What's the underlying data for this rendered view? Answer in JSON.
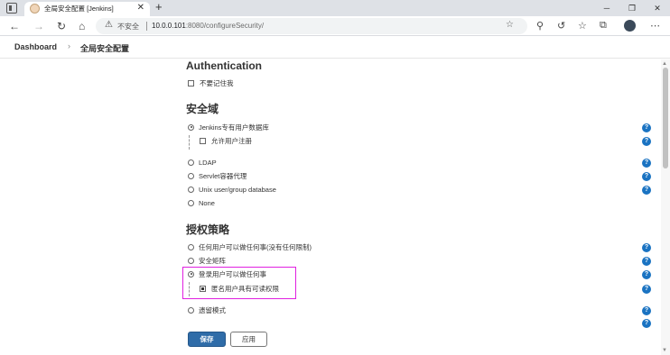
{
  "browser": {
    "tab_title": "全局安全配置 [Jenkins]",
    "tab_close": "✕",
    "new_tab": "+",
    "insecure_label": "不安全",
    "url_host": "10.0.0.101",
    "url_rest": ":8080/configureSecurity/",
    "window_controls": {
      "minimize": "─",
      "maximize": "❐",
      "close": "✕"
    },
    "nav": {
      "back": "←",
      "forward": "→",
      "reload": "↻",
      "home": "⌂"
    }
  },
  "breadcrumb": {
    "items": [
      "Dashboard",
      "全局安全配置"
    ],
    "separator": "›"
  },
  "authentication": {
    "title": "Authentication",
    "remember_me": {
      "label": "不要记住我",
      "checked": false
    }
  },
  "security_realm": {
    "title": "安全域",
    "options": [
      {
        "label": "Jenkins专有用户数据库",
        "selected": true
      },
      {
        "label": "LDAP",
        "selected": false
      },
      {
        "label": "Servlet容器代理",
        "selected": false
      },
      {
        "label": "Unix user/group database",
        "selected": false
      },
      {
        "label": "None",
        "selected": false
      }
    ],
    "allow_signup": {
      "label": "允许用户注册",
      "checked": false
    }
  },
  "authorization": {
    "title": "授权策略",
    "options": [
      {
        "label": "任何用户可以做任何事(没有任何限制)",
        "selected": false
      },
      {
        "label": "安全矩阵",
        "selected": false
      },
      {
        "label": "登录用户可以做任何事",
        "selected": true
      },
      {
        "label": "遗留模式",
        "selected": false
      }
    ],
    "anonymous_read": {
      "label": "匿名用户具有可读权限",
      "checked": true
    }
  },
  "buttons": {
    "save": "保存",
    "apply": "应用"
  },
  "help_glyph": "?",
  "colors": {
    "accent": "#2f6ca8",
    "help": "#1a73c2",
    "highlight": "#e020e0"
  }
}
